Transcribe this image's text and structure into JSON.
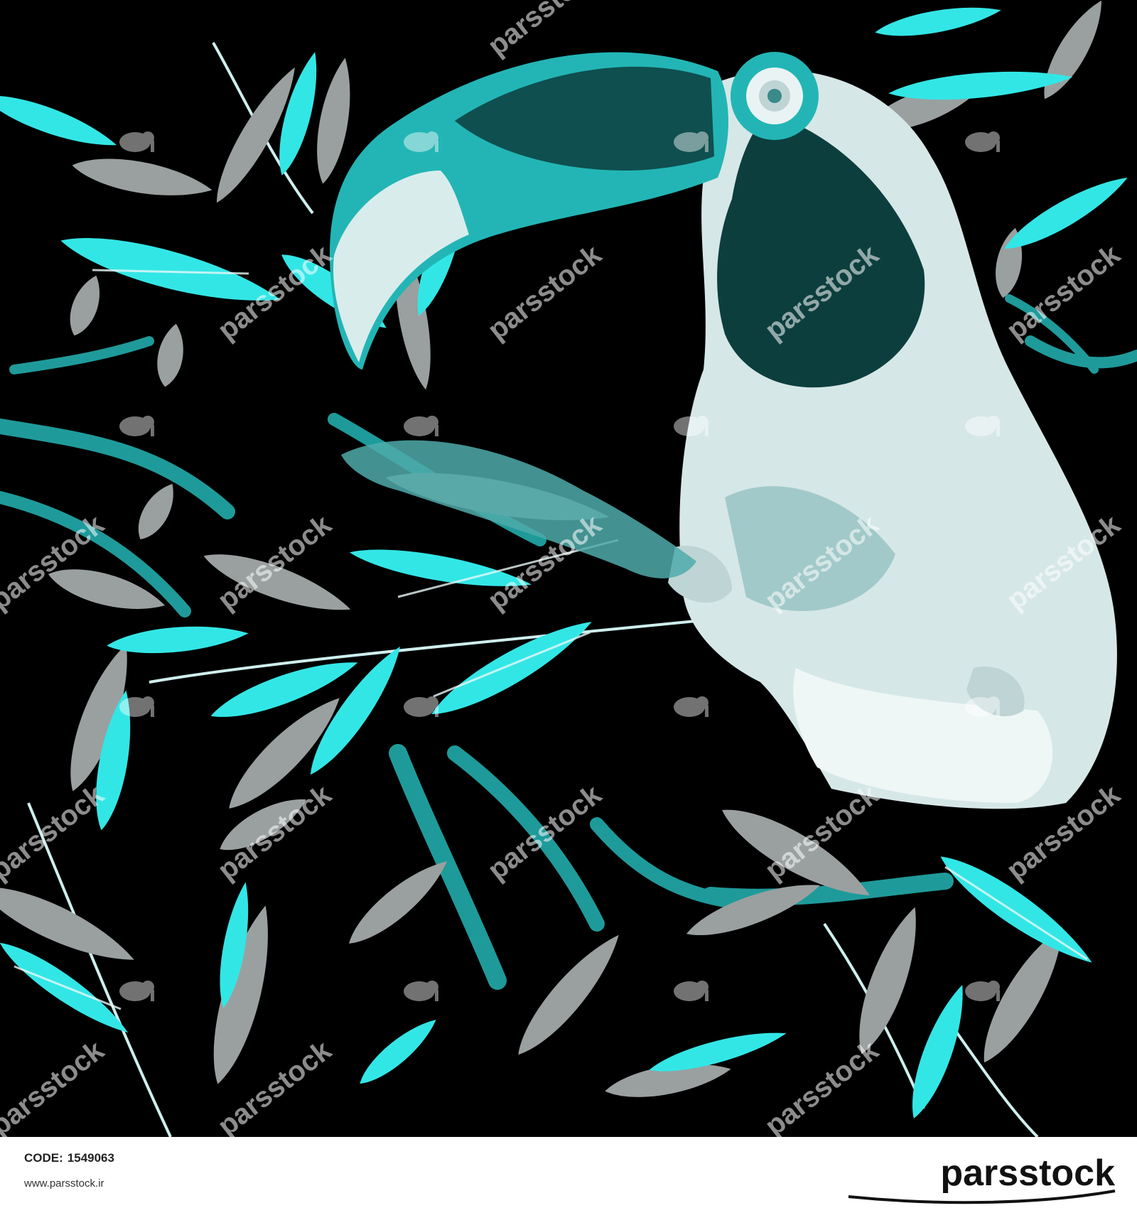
{
  "image": {
    "subject": "toucan",
    "background_color": "#000000",
    "leaf_colors": [
      "#33e6e6",
      "#9aa0a0",
      "#1f9a9a"
    ],
    "bird_colors": [
      "#e9f3f3",
      "#bfd4d4",
      "#0d3e3e",
      "#23b5b5"
    ]
  },
  "watermark": {
    "text": "parsstock",
    "icon": "elephant-icon"
  },
  "footer": {
    "code_label": "CODE:",
    "code_value": "1549063",
    "website": "www.parsstock.ir",
    "logo_text": "parsstock"
  }
}
